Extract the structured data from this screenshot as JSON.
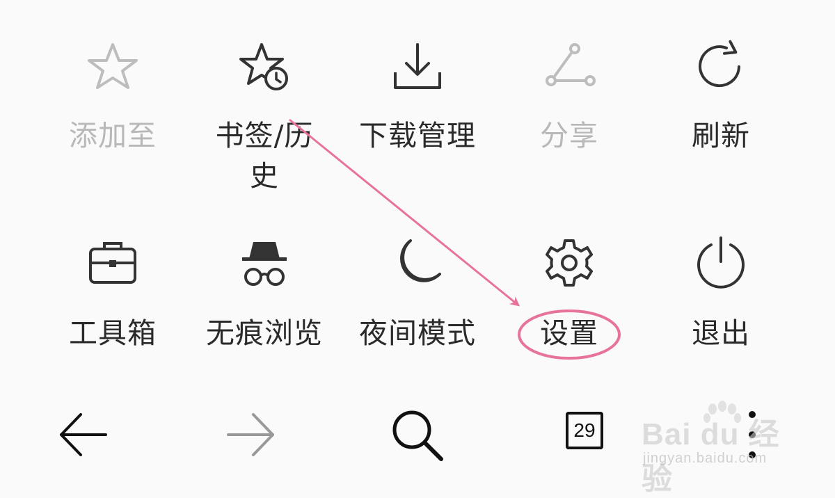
{
  "menu": {
    "row1": [
      {
        "label": "添加至",
        "icon": "star-icon",
        "disabled": true
      },
      {
        "label": "书签/历史",
        "icon": "bookmark-history-icon",
        "disabled": false
      },
      {
        "label": "下载管理",
        "icon": "download-icon",
        "disabled": false
      },
      {
        "label": "分享",
        "icon": "share-icon",
        "disabled": true
      },
      {
        "label": "刷新",
        "icon": "refresh-icon",
        "disabled": false
      }
    ],
    "row2": [
      {
        "label": "工具箱",
        "icon": "toolbox-icon",
        "disabled": false
      },
      {
        "label": "无痕浏览",
        "icon": "incognito-icon",
        "disabled": false
      },
      {
        "label": "夜间模式",
        "icon": "moon-icon",
        "disabled": false
      },
      {
        "label": "设置",
        "icon": "gear-icon",
        "disabled": false,
        "highlighted": true
      },
      {
        "label": "退出",
        "icon": "power-icon",
        "disabled": false
      }
    ]
  },
  "bottom_bar": {
    "back": {
      "icon": "arrow-left-icon"
    },
    "forward": {
      "icon": "arrow-right-icon",
      "disabled": true
    },
    "search": {
      "icon": "search-icon"
    },
    "tabs": {
      "icon": "tabs-icon",
      "count": "29"
    },
    "more": {
      "icon": "more-vertical-icon"
    }
  },
  "annotation": {
    "color": "#e8739a"
  },
  "watermark": {
    "logo": "Bai du 经验",
    "url": "jingyan.baidu.com"
  },
  "colors": {
    "background": "#fafafa",
    "text": "#2a2a2a",
    "disabled": "#b8b8b8",
    "icon": "#333333"
  }
}
